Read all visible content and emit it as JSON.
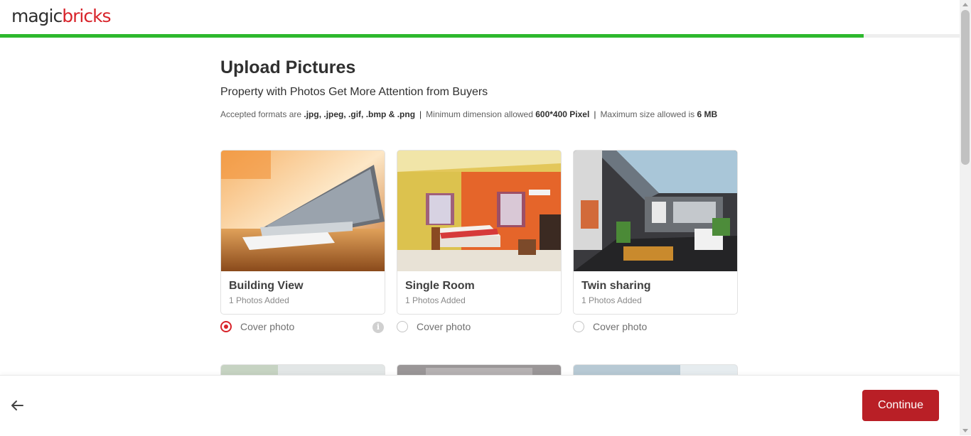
{
  "header": {
    "logo_magic": "magic",
    "logo_bricks": "bricks",
    "progress_fraction": 0.9
  },
  "main": {
    "title": "Upload Pictures",
    "subtitle": "Property with Photos Get More Attention from Buyers",
    "formats_prefix": "Accepted formats are ",
    "formats_value": ".jpg, .jpeg, .gif, .bmp & .png",
    "dimension_prefix": "Minimum dimension allowed ",
    "dimension_value": "600*400 Pixel",
    "size_prefix": "Maximum size allowed is ",
    "size_value": "6 MB",
    "separator": "|"
  },
  "cards": [
    {
      "name": "Building View",
      "count": "1 Photos Added",
      "cover_label": "Cover photo",
      "cover_selected": true
    },
    {
      "name": "Single Room",
      "count": "1 Photos Added",
      "cover_label": "Cover photo",
      "cover_selected": false
    },
    {
      "name": "Twin sharing",
      "count": "1 Photos Added",
      "cover_label": "Cover photo",
      "cover_selected": false
    }
  ],
  "footer": {
    "back_icon": "arrow-left-icon",
    "continue_label": "Continue"
  },
  "colors": {
    "brand_red": "#d8232a",
    "button_red": "#b91f26",
    "progress_green": "#2db82d"
  }
}
